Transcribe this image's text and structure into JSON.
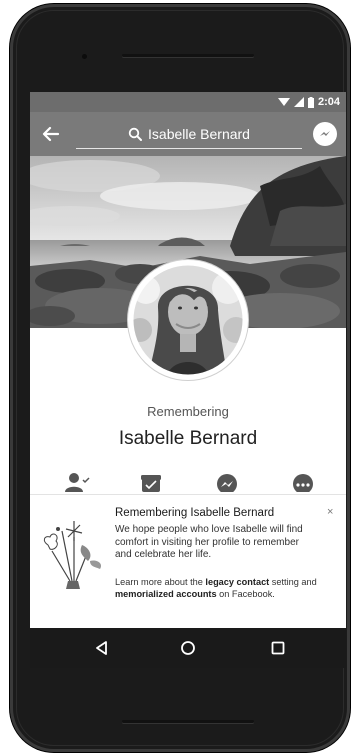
{
  "status_bar": {
    "time": "2:04"
  },
  "search": {
    "query": "Isabelle Bernard"
  },
  "profile": {
    "remembering_label": "Remembering",
    "name": "Isabelle Bernard"
  },
  "memorial_card": {
    "title": "Remembering Isabelle Bernard",
    "body": "We hope people who love Isabelle will find comfort in visiting her profile to remember and celebrate her life.",
    "more_prefix": "Learn more about the ",
    "legacy_contact": "legacy contact",
    "more_middle": " setting and ",
    "memorialized_accounts": "memorialized accounts",
    "more_suffix": " on Facebook.",
    "close_glyph": "×"
  },
  "icons": {
    "back": "arrow-left-icon",
    "search": "search-icon",
    "messenger": "messenger-icon",
    "friends": "friend-check-icon",
    "gift": "gift-icon",
    "message": "messenger-icon",
    "more": "more-icon"
  },
  "colors": {
    "header_gray": "#7a7a7a",
    "status_gray": "#6d6d6d",
    "nav_black": "#1a1a1a",
    "phone_body": "#1b1b1b"
  }
}
